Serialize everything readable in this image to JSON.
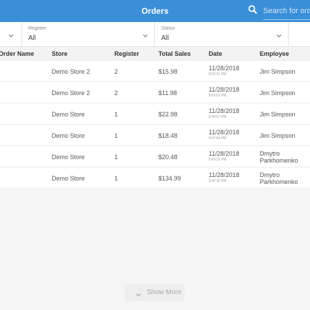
{
  "header": {
    "title": "Orders"
  },
  "search": {
    "placeholder": "Search for orders"
  },
  "filters": [
    {
      "label": "",
      "value": ""
    },
    {
      "label": "Register",
      "value": "All"
    },
    {
      "label": "Status",
      "value": "All"
    }
  ],
  "table": {
    "columns": [
      "Order Name",
      "Store",
      "Register",
      "Total Sales",
      "Date",
      "Employee"
    ],
    "rows": [
      {
        "order_name": "",
        "store": "Demo Store 2",
        "register": "2",
        "total": "$15.98",
        "date": "11/28/2018",
        "time": "8:52:11 PM",
        "employee": "Jim Simpson"
      },
      {
        "order_name": "",
        "store": "Demo Store 2",
        "register": "2",
        "total": "$11.98",
        "date": "11/28/2018",
        "time": "8:52:01 PM",
        "employee": "Jim Simpson"
      },
      {
        "order_name": "",
        "store": "Demo Store",
        "register": "1",
        "total": "$22.98",
        "date": "11/28/2018",
        "time": "8:48:07 PM",
        "employee": "Jim Simpson"
      },
      {
        "order_name": "",
        "store": "Demo Store",
        "register": "1",
        "total": "$18.48",
        "date": "11/28/2018",
        "time": "8:47:54 PM",
        "employee": "Jim Simpson"
      },
      {
        "order_name": "",
        "store": "Demo Store",
        "register": "1",
        "total": "$20.48",
        "date": "11/28/2018",
        "time": "8:43:31 PM",
        "employee": "Dmytro Parkhomenko"
      },
      {
        "order_name": "",
        "store": "Demo Store",
        "register": "1",
        "total": "$134.99",
        "date": "11/28/2018",
        "time": "8:42:22 PM",
        "employee": "Dmytro Parkhomenko"
      }
    ]
  },
  "footer": {
    "show_more_label": "Show More"
  },
  "icons": {
    "search": "search-icon",
    "chevron": "chevron-down-icon"
  },
  "colors": {
    "header_bg": "#3a8fd8",
    "header_text": "#ffffff",
    "table_header_bg": "#f3f3f3"
  }
}
